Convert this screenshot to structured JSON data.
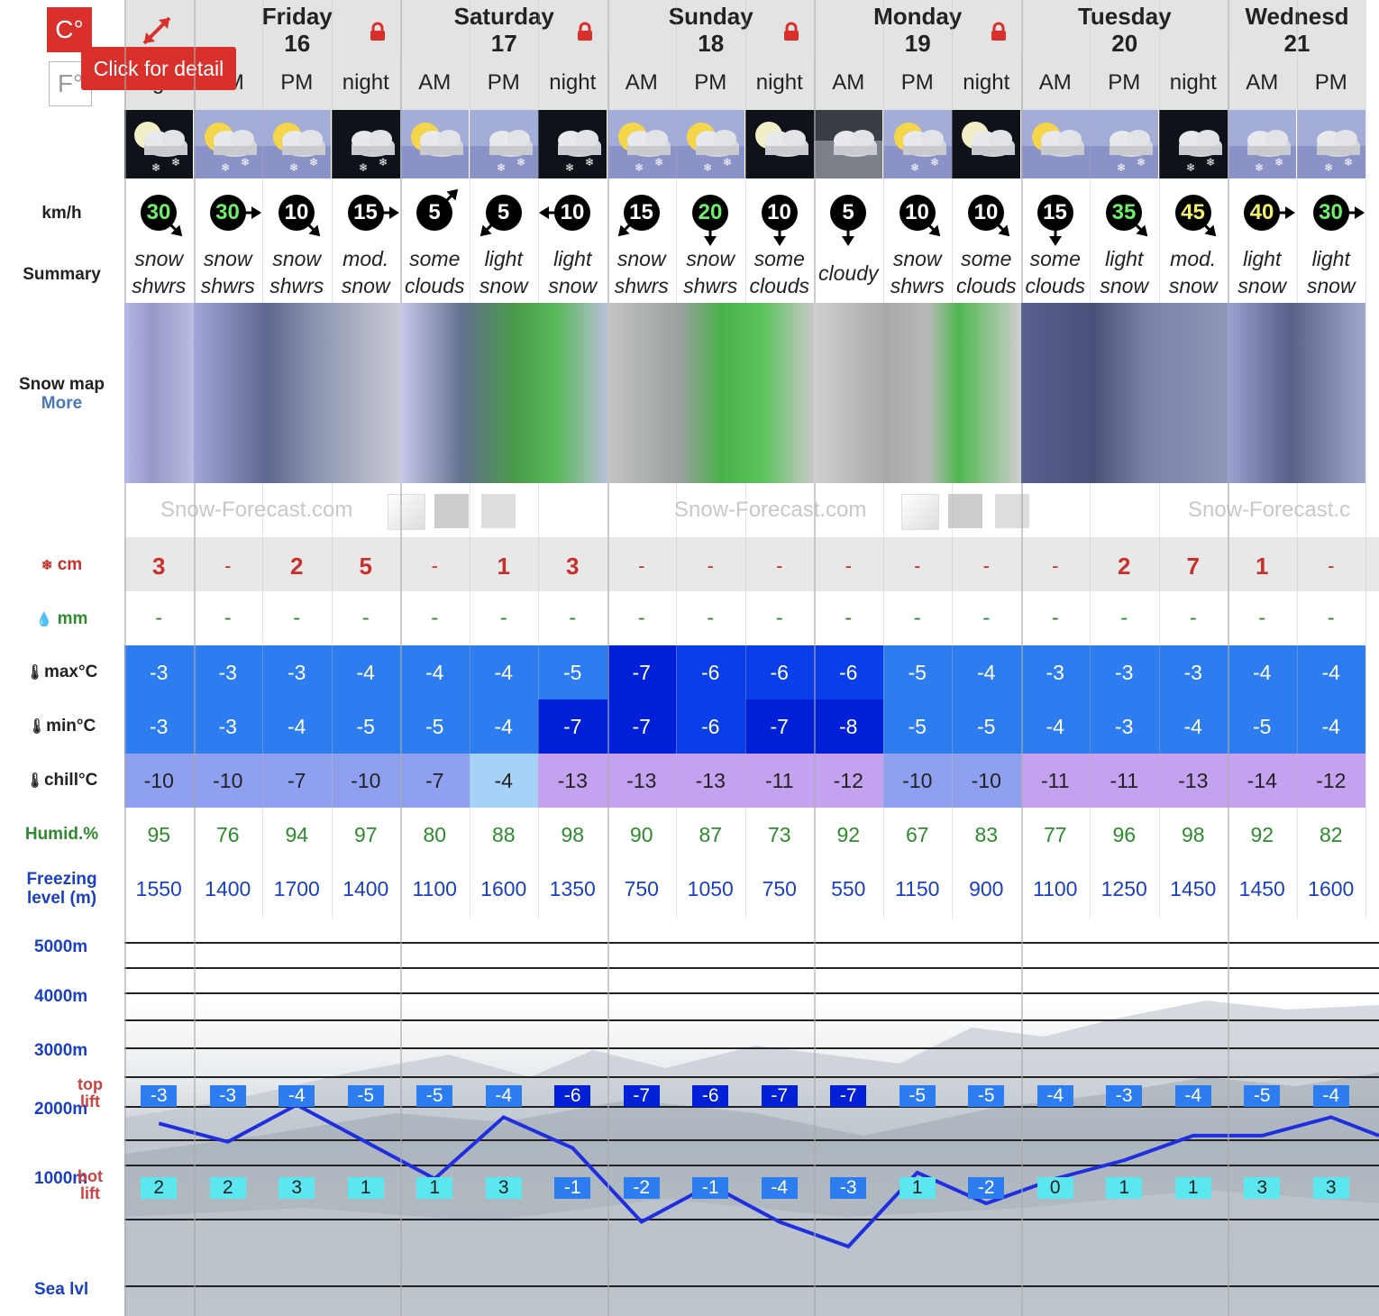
{
  "units": {
    "celsius": "C°",
    "fahrenheit": "F°"
  },
  "tooltip": "Click for detail",
  "labels": {
    "wind": "km/h",
    "summary": "Summary",
    "snow_map": "Snow map",
    "more": "More",
    "snow": "cm",
    "rain": "mm",
    "max": "max°C",
    "min": "min°C",
    "chill": "chill°C",
    "humid": "Humid.%",
    "freezing_1": "Freezing",
    "freezing_2": "level (m)",
    "alt_5000": "5000m",
    "alt_4000": "4000m",
    "alt_3000": "3000m",
    "alt_2000": "2000m",
    "alt_1000": "1000m",
    "sea": "Sea lvl",
    "top_lift_1": "top",
    "top_lift_2": "lift",
    "bot_lift_1": "bot",
    "bot_lift_2": "lift"
  },
  "watermark": "Snow-Forecast.com",
  "watermark_partial": "Snow-Forecast.c",
  "days": [
    {
      "name": "",
      "num": "",
      "locked": false
    },
    {
      "name": "Friday",
      "num": "16",
      "locked": true
    },
    {
      "name": "Saturday",
      "num": "17",
      "locked": true
    },
    {
      "name": "Sunday",
      "num": "18",
      "locked": true
    },
    {
      "name": "Monday",
      "num": "19",
      "locked": true
    },
    {
      "name": "Tuesday",
      "num": "20",
      "locked": false
    },
    {
      "name": "Wednesd",
      "num": "21",
      "locked": false
    }
  ],
  "periods": [
    {
      "p": "night",
      "wx": "moon-cloud-snow",
      "wind": "30",
      "wcol": "g",
      "wdir": "se",
      "s1": "snow",
      "s2": "shwrs",
      "snow": "3",
      "rain": "-",
      "max": "-3",
      "min": "-3",
      "chill": "-10",
      "hum": "95",
      "frz": "1550",
      "top": "-3",
      "bot": "2"
    },
    {
      "p": "AM",
      "wx": "sun-cloud-snow",
      "wind": "30",
      "wcol": "g",
      "wdir": "e",
      "s1": "snow",
      "s2": "shwrs",
      "snow": "-",
      "rain": "-",
      "max": "-3",
      "min": "-3",
      "chill": "-10",
      "hum": "76",
      "frz": "1400",
      "top": "-3",
      "bot": "2"
    },
    {
      "p": "PM",
      "wx": "sun-cloud-snow",
      "wind": "10",
      "wcol": "w",
      "wdir": "se",
      "s1": "snow",
      "s2": "shwrs",
      "snow": "2",
      "rain": "-",
      "max": "-3",
      "min": "-4",
      "chill": "-7",
      "hum": "94",
      "frz": "1700",
      "top": "-4",
      "bot": "3"
    },
    {
      "p": "night",
      "wx": "cloud-snow-night",
      "wind": "15",
      "wcol": "w",
      "wdir": "e",
      "s1": "mod.",
      "s2": "snow",
      "snow": "5",
      "rain": "-",
      "max": "-4",
      "min": "-5",
      "chill": "-10",
      "hum": "97",
      "frz": "1400",
      "top": "-5",
      "bot": "1"
    },
    {
      "p": "AM",
      "wx": "sun-cloud",
      "wind": "5",
      "wcol": "w",
      "wdir": "ne",
      "s1": "some",
      "s2": "clouds",
      "snow": "-",
      "rain": "-",
      "max": "-4",
      "min": "-5",
      "chill": "-7",
      "hum": "80",
      "frz": "1100",
      "top": "-5",
      "bot": "1"
    },
    {
      "p": "PM",
      "wx": "cloud-snow",
      "wind": "5",
      "wcol": "w",
      "wdir": "sw",
      "s1": "light",
      "s2": "snow",
      "snow": "1",
      "rain": "-",
      "max": "-4",
      "min": "-4",
      "chill": "-4",
      "hum": "88",
      "frz": "1600",
      "top": "-4",
      "bot": "3"
    },
    {
      "p": "night",
      "wx": "cloud-snow-night",
      "wind": "10",
      "wcol": "w",
      "wdir": "w",
      "s1": "light",
      "s2": "snow",
      "snow": "3",
      "rain": "-",
      "max": "-5",
      "min": "-7",
      "chill": "-13",
      "hum": "98",
      "frz": "1350",
      "top": "-6",
      "bot": "-1"
    },
    {
      "p": "AM",
      "wx": "sun-cloud-snow",
      "wind": "15",
      "wcol": "w",
      "wdir": "sw",
      "s1": "snow",
      "s2": "shwrs",
      "snow": "-",
      "rain": "-",
      "max": "-7",
      "min": "-7",
      "chill": "-13",
      "hum": "90",
      "frz": "750",
      "top": "-7",
      "bot": "-2"
    },
    {
      "p": "PM",
      "wx": "sun-cloud-snow",
      "wind": "20",
      "wcol": "g",
      "wdir": "s",
      "s1": "snow",
      "s2": "shwrs",
      "snow": "-",
      "rain": "-",
      "max": "-6",
      "min": "-6",
      "chill": "-13",
      "hum": "87",
      "frz": "1050",
      "top": "-6",
      "bot": "-1"
    },
    {
      "p": "night",
      "wx": "moon-cloud",
      "wind": "10",
      "wcol": "w",
      "wdir": "s",
      "s1": "some",
      "s2": "clouds",
      "snow": "-",
      "rain": "-",
      "max": "-6",
      "min": "-7",
      "chill": "-11",
      "hum": "73",
      "frz": "750",
      "top": "-7",
      "bot": "-4"
    },
    {
      "p": "AM",
      "wx": "cloud",
      "wind": "5",
      "wcol": "w",
      "wdir": "s",
      "s1": "cloudy",
      "s2": "",
      "snow": "-",
      "rain": "-",
      "max": "-6",
      "min": "-8",
      "chill": "-12",
      "hum": "92",
      "frz": "550",
      "top": "-7",
      "bot": "-3"
    },
    {
      "p": "PM",
      "wx": "sun-cloud-snow",
      "wind": "10",
      "wcol": "w",
      "wdir": "se",
      "s1": "snow",
      "s2": "shwrs",
      "snow": "-",
      "rain": "-",
      "max": "-5",
      "min": "-5",
      "chill": "-10",
      "hum": "67",
      "frz": "1150",
      "top": "-5",
      "bot": "1"
    },
    {
      "p": "night",
      "wx": "moon-cloud",
      "wind": "10",
      "wcol": "w",
      "wdir": "se",
      "s1": "some",
      "s2": "clouds",
      "snow": "-",
      "rain": "-",
      "max": "-4",
      "min": "-5",
      "chill": "-10",
      "hum": "83",
      "frz": "900",
      "top": "-5",
      "bot": "-2"
    },
    {
      "p": "AM",
      "wx": "sun-cloud",
      "wind": "15",
      "wcol": "w",
      "wdir": "s",
      "s1": "some",
      "s2": "clouds",
      "snow": "-",
      "rain": "-",
      "max": "-3",
      "min": "-4",
      "chill": "-11",
      "hum": "77",
      "frz": "1100",
      "top": "-4",
      "bot": "0"
    },
    {
      "p": "PM",
      "wx": "cloud-snow",
      "wind": "35",
      "wcol": "g",
      "wdir": "se",
      "s1": "light",
      "s2": "snow",
      "snow": "2",
      "rain": "-",
      "max": "-3",
      "min": "-3",
      "chill": "-11",
      "hum": "96",
      "frz": "1250",
      "top": "-3",
      "bot": "1"
    },
    {
      "p": "night",
      "wx": "cloud-snow-night",
      "wind": "45",
      "wcol": "y",
      "wdir": "se",
      "s1": "mod.",
      "s2": "snow",
      "snow": "7",
      "rain": "-",
      "max": "-3",
      "min": "-4",
      "chill": "-13",
      "hum": "98",
      "frz": "1450",
      "top": "-4",
      "bot": "1"
    },
    {
      "p": "AM",
      "wx": "cloud-snow",
      "wind": "40",
      "wcol": "y",
      "wdir": "e",
      "s1": "light",
      "s2": "snow",
      "snow": "1",
      "rain": "-",
      "max": "-4",
      "min": "-5",
      "chill": "-14",
      "hum": "92",
      "frz": "1450",
      "top": "-5",
      "bot": "3"
    },
    {
      "p": "PM",
      "wx": "cloud-snow",
      "wind": "30",
      "wcol": "g",
      "wdir": "e",
      "s1": "light",
      "s2": "snow",
      "snow": "-",
      "rain": "-",
      "max": "-4",
      "min": "-4",
      "chill": "-12",
      "hum": "82",
      "frz": "1600",
      "top": "-4",
      "bot": "3"
    }
  ],
  "colors": {
    "temp_mid": "#2d7df0",
    "temp_cold": "#0a3ee8",
    "temp_colder": "#0020d8",
    "chill_mid": "#8fa0f0",
    "chill_warm": "#a6d2f8",
    "chill_cold": "#c4a2f0",
    "freeze_line": "#1f2fe0",
    "snow_red": "#c9302c"
  }
}
